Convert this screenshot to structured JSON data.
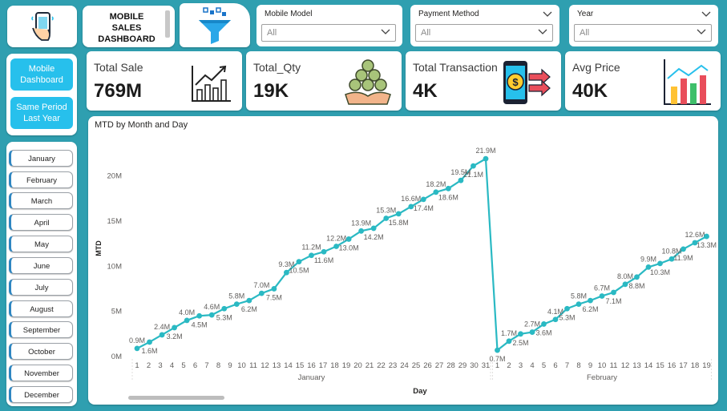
{
  "header": {
    "title_lines": [
      "MOBILE",
      "SALES",
      "DASHBOARD"
    ],
    "slicers": [
      {
        "title": "Mobile Model",
        "value": "All"
      },
      {
        "title": "Payment Method",
        "value": "All"
      },
      {
        "title": "Year",
        "value": "All"
      }
    ]
  },
  "nav": {
    "buttons": [
      {
        "label": "Mobile Dashboard"
      },
      {
        "label": "Same Period Last Year"
      }
    ]
  },
  "months": [
    "January",
    "February",
    "March",
    "April",
    "May",
    "June",
    "July",
    "August",
    "September",
    "October",
    "November",
    "December"
  ],
  "kpis": [
    {
      "label": "Total Sale",
      "value": "769M",
      "icon": "line-chart-icon"
    },
    {
      "label": "Total_Qty",
      "value": "19K",
      "icon": "coins-hand-icon"
    },
    {
      "label": "Total Transaction",
      "value": "4K",
      "icon": "phone-payment-icon"
    },
    {
      "label": "Avg Price",
      "value": "40K",
      "icon": "bar-chart-icon"
    }
  ],
  "colors": {
    "accent": "#2ab9c3",
    "button": "#27c0ec",
    "background": "#2f9fb0"
  },
  "chart_data": {
    "type": "line",
    "title": "MTD by Month and Day",
    "xlabel": "Day",
    "ylabel": "MTD",
    "ylim": [
      0,
      22
    ],
    "y_ticks": [
      "0M",
      "5M",
      "10M",
      "15M",
      "20M"
    ],
    "groups": [
      {
        "name": "January",
        "days": [
          1,
          2,
          3,
          4,
          5,
          6,
          7,
          8,
          9,
          10,
          11,
          12,
          13,
          14,
          15,
          16,
          17,
          18,
          19,
          20,
          21,
          22,
          23,
          24,
          25,
          26,
          27,
          28,
          29,
          30,
          31
        ],
        "values": [
          0.9,
          1.6,
          2.4,
          3.2,
          4.0,
          4.5,
          4.6,
          5.3,
          5.8,
          6.2,
          7.0,
          7.5,
          9.3,
          10.5,
          11.2,
          11.6,
          12.2,
          13.0,
          13.9,
          14.2,
          15.3,
          15.8,
          16.6,
          17.4,
          18.2,
          18.6,
          19.5,
          21.1,
          21.9
        ],
        "labels": [
          "0.9M",
          "1.6M",
          "2.4M",
          "3.2M",
          "4.0M",
          "4.5M",
          "4.6M",
          "5.3M",
          "5.8M",
          "6.2M",
          "7.0M",
          "7.5M",
          "9.3M",
          "10.5M",
          "11.2M",
          "11.6M",
          "12.2M",
          "13.0M",
          "13.9M",
          "14.2M",
          "15.3M",
          "15.8M",
          "16.6M",
          "17.4M",
          "18.2M",
          "18.6M",
          "19.5M",
          "21.1M",
          "21.9M"
        ]
      },
      {
        "name": "February",
        "days": [
          1,
          2,
          3,
          4,
          5,
          6,
          7,
          8,
          9,
          10,
          11,
          12,
          13,
          14,
          15,
          16,
          17,
          18,
          19
        ],
        "values": [
          0.7,
          1.7,
          2.5,
          2.7,
          3.6,
          4.1,
          5.3,
          5.8,
          6.2,
          6.7,
          7.1,
          8.0,
          8.8,
          9.9,
          10.3,
          10.8,
          11.9,
          12.6,
          13.3
        ],
        "labels": [
          "0.7M",
          "1.7M",
          "2.5M",
          "2.7M",
          "3.6M",
          "4.1M",
          "5.3M",
          "5.8M",
          "6.2M",
          "6.7M",
          "7.1M",
          "8.0M",
          "8.8M",
          "9.9M",
          "10.3M",
          "10.8M",
          "11.9M",
          "12.6M",
          "13.3M"
        ]
      }
    ]
  }
}
